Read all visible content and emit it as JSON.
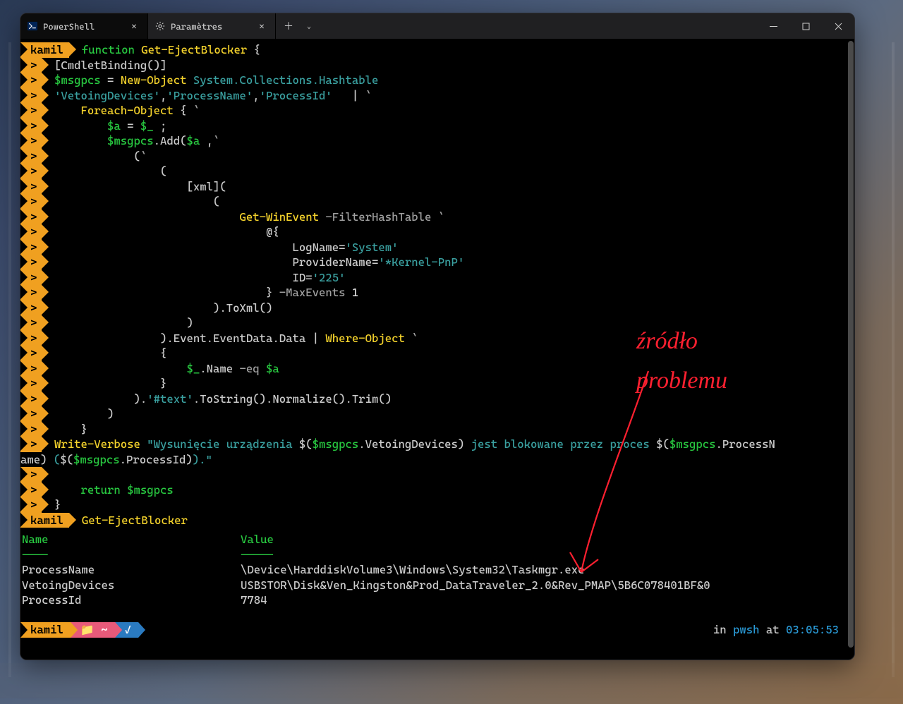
{
  "tabs": {
    "active": {
      "label": "PowerShell"
    },
    "second": {
      "label": "Paramètres"
    }
  },
  "prompt_user": "kamil",
  "code_lines": [
    [
      [
        "kw",
        "function"
      ],
      [
        "txt",
        " "
      ],
      [
        "cmd",
        "Get-EjectBlocker"
      ],
      [
        "txt",
        " {"
      ]
    ],
    [
      [
        "txt",
        "["
      ],
      [
        "txt",
        "CmdletBinding"
      ],
      [
        "txt",
        "()]"
      ]
    ],
    [
      [
        "var",
        "$msgpcs"
      ],
      [
        "txt",
        " = "
      ],
      [
        "cmd",
        "New-Object"
      ],
      [
        "txt",
        " "
      ],
      [
        "type",
        "System.Collections.Hashtable"
      ]
    ],
    [
      [
        "str",
        "'VetoingDevices'"
      ],
      [
        "txt",
        ","
      ],
      [
        "str",
        "'ProcessName'"
      ],
      [
        "txt",
        ","
      ],
      [
        "str",
        "'ProcessId'"
      ],
      [
        "txt",
        "   "
      ],
      [
        "pipe",
        "|"
      ],
      [
        "txt",
        " "
      ],
      [
        "op",
        "`"
      ]
    ],
    [
      [
        "txt",
        "    "
      ],
      [
        "cmd",
        "Foreach-Object"
      ],
      [
        "txt",
        " { "
      ],
      [
        "op",
        "`"
      ]
    ],
    [
      [
        "txt",
        "        "
      ],
      [
        "var",
        "$a"
      ],
      [
        "txt",
        " = "
      ],
      [
        "var",
        "$_"
      ],
      [
        "txt",
        " ;"
      ]
    ],
    [
      [
        "txt",
        "        "
      ],
      [
        "var",
        "$msgpcs"
      ],
      [
        "txt",
        ".Add("
      ],
      [
        "var",
        "$a"
      ],
      [
        "txt",
        " ,"
      ],
      [
        "op",
        "`"
      ]
    ],
    [
      [
        "txt",
        "            ("
      ],
      [
        "op",
        "`"
      ]
    ],
    [
      [
        "txt",
        "                ("
      ]
    ],
    [
      [
        "txt",
        "                    [xml]("
      ]
    ],
    [
      [
        "txt",
        "                        ("
      ]
    ],
    [
      [
        "txt",
        "                            "
      ],
      [
        "cmd",
        "Get-WinEvent"
      ],
      [
        "txt",
        " "
      ],
      [
        "param",
        "-FilterHashTable"
      ],
      [
        "txt",
        " "
      ],
      [
        "op",
        "`"
      ]
    ],
    [
      [
        "txt",
        "                                @{"
      ]
    ],
    [
      [
        "txt",
        "                                    LogName="
      ],
      [
        "str",
        "'System'"
      ]
    ],
    [
      [
        "txt",
        "                                    ProviderName="
      ],
      [
        "str",
        "'*Kernel-PnP'"
      ]
    ],
    [
      [
        "txt",
        "                                    ID="
      ],
      [
        "str",
        "'225'"
      ]
    ],
    [
      [
        "txt",
        "                                } "
      ],
      [
        "param",
        "-MaxEvents"
      ],
      [
        "txt",
        " "
      ],
      [
        "num",
        "1"
      ]
    ],
    [
      [
        "txt",
        "                        ).ToXml()"
      ]
    ],
    [
      [
        "txt",
        "                    )"
      ]
    ],
    [
      [
        "txt",
        "                ).Event.EventData.Data "
      ],
      [
        "pipe",
        "|"
      ],
      [
        "txt",
        " "
      ],
      [
        "cmd",
        "Where-Object"
      ],
      [
        "txt",
        " "
      ],
      [
        "op",
        "`"
      ]
    ],
    [
      [
        "txt",
        "                {"
      ]
    ],
    [
      [
        "txt",
        "                    "
      ],
      [
        "var",
        "$_"
      ],
      [
        "txt",
        ".Name "
      ],
      [
        "param",
        "-eq"
      ],
      [
        "txt",
        " "
      ],
      [
        "var",
        "$a"
      ]
    ],
    [
      [
        "txt",
        "                }"
      ]
    ],
    [
      [
        "txt",
        "            )."
      ],
      [
        "str",
        "'#text'"
      ],
      [
        "txt",
        ".ToString().Normalize().Trim()"
      ]
    ],
    [
      [
        "txt",
        "        )"
      ]
    ],
    [
      [
        "txt",
        "    }"
      ]
    ]
  ],
  "verbose_line": {
    "pre": "Write-Verbose ",
    "s1": "\"Wysunięcie urządzenia ",
    "s2": "$(",
    "v1": "$msgpcs",
    "s3": ".VetoingDevices)",
    "s4": " jest blokowane przez proces ",
    "s5": "$(",
    "v2": "$msgpcs",
    "s6": ".ProcessN",
    "wrap1": "ame) ",
    "s7": "(",
    "s8": "$(",
    "v3": "$msgpcs",
    "s9": ".ProcessId)",
    "s10": ")",
    "s11": ".\""
  },
  "after_lines": [
    [
      [
        "txt",
        ""
      ]
    ],
    [
      [
        "txt",
        "    "
      ],
      [
        "kw",
        "return"
      ],
      [
        "txt",
        " "
      ],
      [
        "var",
        "$msgpcs"
      ]
    ],
    [
      [
        "txt",
        "}"
      ]
    ]
  ],
  "exec_cmd": "Get-EjectBlocker",
  "output": {
    "headers": {
      "name": "Name",
      "value": "Value"
    },
    "sep": {
      "name": "----",
      "value": "-----"
    },
    "rows": [
      {
        "name": "ProcessName",
        "value": "\\Device\\HarddiskVolume3\\Windows\\System32\\Taskmgr.exe"
      },
      {
        "name": "VetoingDevices",
        "value": "USBSTOR\\Disk&Ven_Kingston&Prod_DataTraveler_2.0&Rev_PMAP\\5B6C078401BF&0"
      },
      {
        "name": "ProcessId",
        "value": "7784"
      }
    ]
  },
  "status": {
    "user": "kamil",
    "path_icon": "📁",
    "path": "~",
    "check": "✓",
    "right_in": "in ",
    "shell": "pwsh",
    "right_at": " at ",
    "time": "03:05:53"
  },
  "annotation": {
    "line1": "źródło",
    "line2": "problemu"
  }
}
